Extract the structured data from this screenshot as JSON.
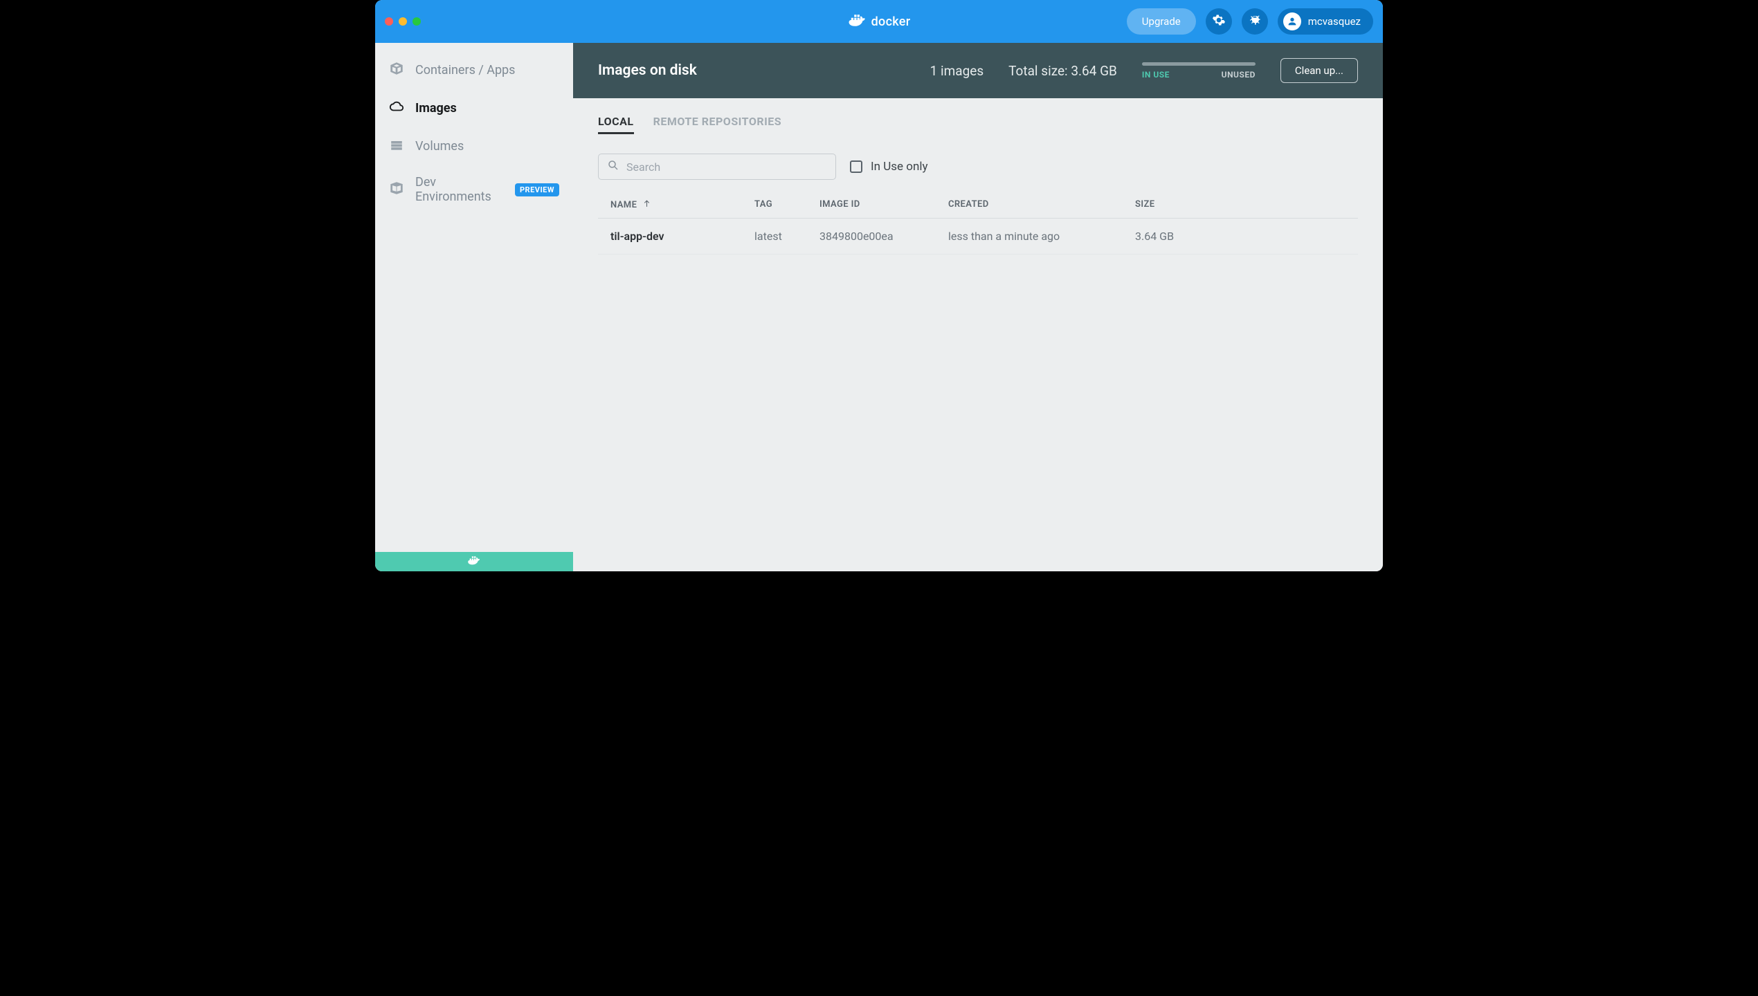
{
  "titlebar": {
    "logo_text": "docker",
    "upgrade_label": "Upgrade",
    "username": "mcvasquez"
  },
  "sidebar": {
    "items": [
      {
        "label": "Containers / Apps"
      },
      {
        "label": "Images"
      },
      {
        "label": "Volumes"
      },
      {
        "label": "Dev Environments",
        "badge": "PREVIEW"
      }
    ]
  },
  "disk_header": {
    "title": "Images on disk",
    "count": "1 images",
    "total_size": "Total size: 3.64 GB",
    "in_use_label": "IN USE",
    "unused_label": "UNUSED",
    "cleanup_label": "Clean up..."
  },
  "tabs": {
    "local": "LOCAL",
    "remote": "REMOTE REPOSITORIES"
  },
  "filters": {
    "search_placeholder": "Search",
    "in_use_only_label": "In Use only"
  },
  "table": {
    "headers": {
      "name": "NAME",
      "tag": "TAG",
      "image_id": "IMAGE ID",
      "created": "CREATED",
      "size": "SIZE"
    },
    "rows": [
      {
        "name": "til-app-dev",
        "tag": "latest",
        "image_id": "3849800e00ea",
        "created": "less than a minute ago",
        "size": "3.64 GB"
      }
    ]
  }
}
